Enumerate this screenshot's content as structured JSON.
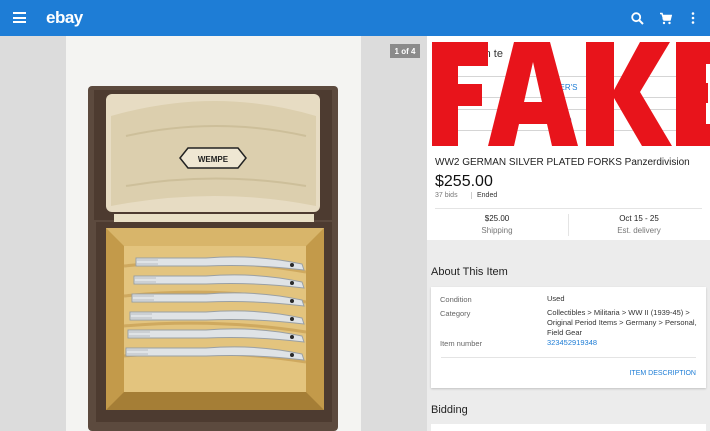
{
  "header": {
    "logo": "ebay",
    "icons": [
      "menu-icon",
      "search-icon",
      "cart-icon",
      "more-vert-icon"
    ],
    "color": "#1e7dd6"
  },
  "gallery": {
    "counter": "1 of 4",
    "case_brand": "WEMPE"
  },
  "listing": {
    "offer_text": "u m      t on     te",
    "button1_label": "ER'S",
    "button2_label": "O",
    "title": "WW2 GERMAN SILVER PLATED FORKS Panzerdivision",
    "price": "$255.00",
    "bids": "37 bids",
    "status": "Ended",
    "shipping_value": "$25.00",
    "shipping_label": "Shipping",
    "delivery_value": "Oct 15 - 25",
    "delivery_label": "Est. delivery"
  },
  "about": {
    "heading": "About This Item",
    "condition_label": "Condition",
    "condition_value": "Used",
    "category_label": "Category",
    "category_value": "Collectibles > Militaria > WW II (1939-45) > Original Period Items > Germany > Personal, Field Gear",
    "item_number_label": "Item number",
    "item_number_value": "323452919348",
    "item_description": "ITEM DESCRIPTION"
  },
  "bidding": {
    "heading": "Bidding"
  },
  "overlay": {
    "stamp": "FAKE",
    "stamp_color": "#e8141b"
  }
}
